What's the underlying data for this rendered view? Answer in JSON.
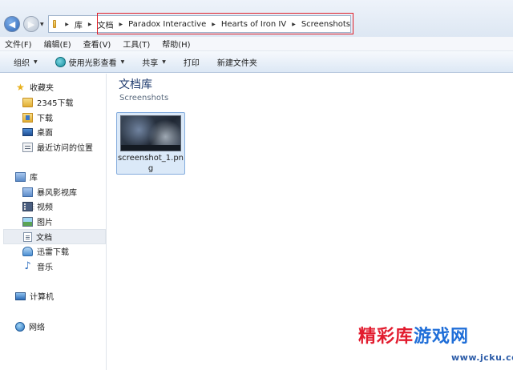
{
  "address": {
    "crumbs": [
      "库",
      "文档",
      "Paradox Interactive",
      "Hearts of Iron IV",
      "Screenshots"
    ],
    "highlight_color": "#e0212b"
  },
  "menu": [
    "文件(F)",
    "编辑(E)",
    "查看(V)",
    "工具(T)",
    "帮助(H)"
  ],
  "toolbar": {
    "organize": "组织",
    "open_with": "使用光影查看",
    "share": "共享",
    "print": "打印",
    "new_folder": "新建文件夹"
  },
  "sidebar": {
    "favorites": {
      "label": "收藏夹",
      "items": [
        "2345下载",
        "下载",
        "桌面",
        "最近访问的位置"
      ]
    },
    "libraries": {
      "label": "库",
      "items": [
        "暴风影视库",
        "视频",
        "图片",
        "文档",
        "迅雷下载",
        "音乐"
      ],
      "selected": "文档"
    },
    "computer": "计算机",
    "network": "网络"
  },
  "content": {
    "title": "文档库",
    "subtitle": "Screenshots",
    "files": [
      {
        "name": "screenshot_1.png",
        "icon": "image-thumbnail"
      }
    ]
  },
  "watermark": {
    "part1": "精彩库",
    "part2": "游戏网",
    "url": "www.jcku.com"
  }
}
